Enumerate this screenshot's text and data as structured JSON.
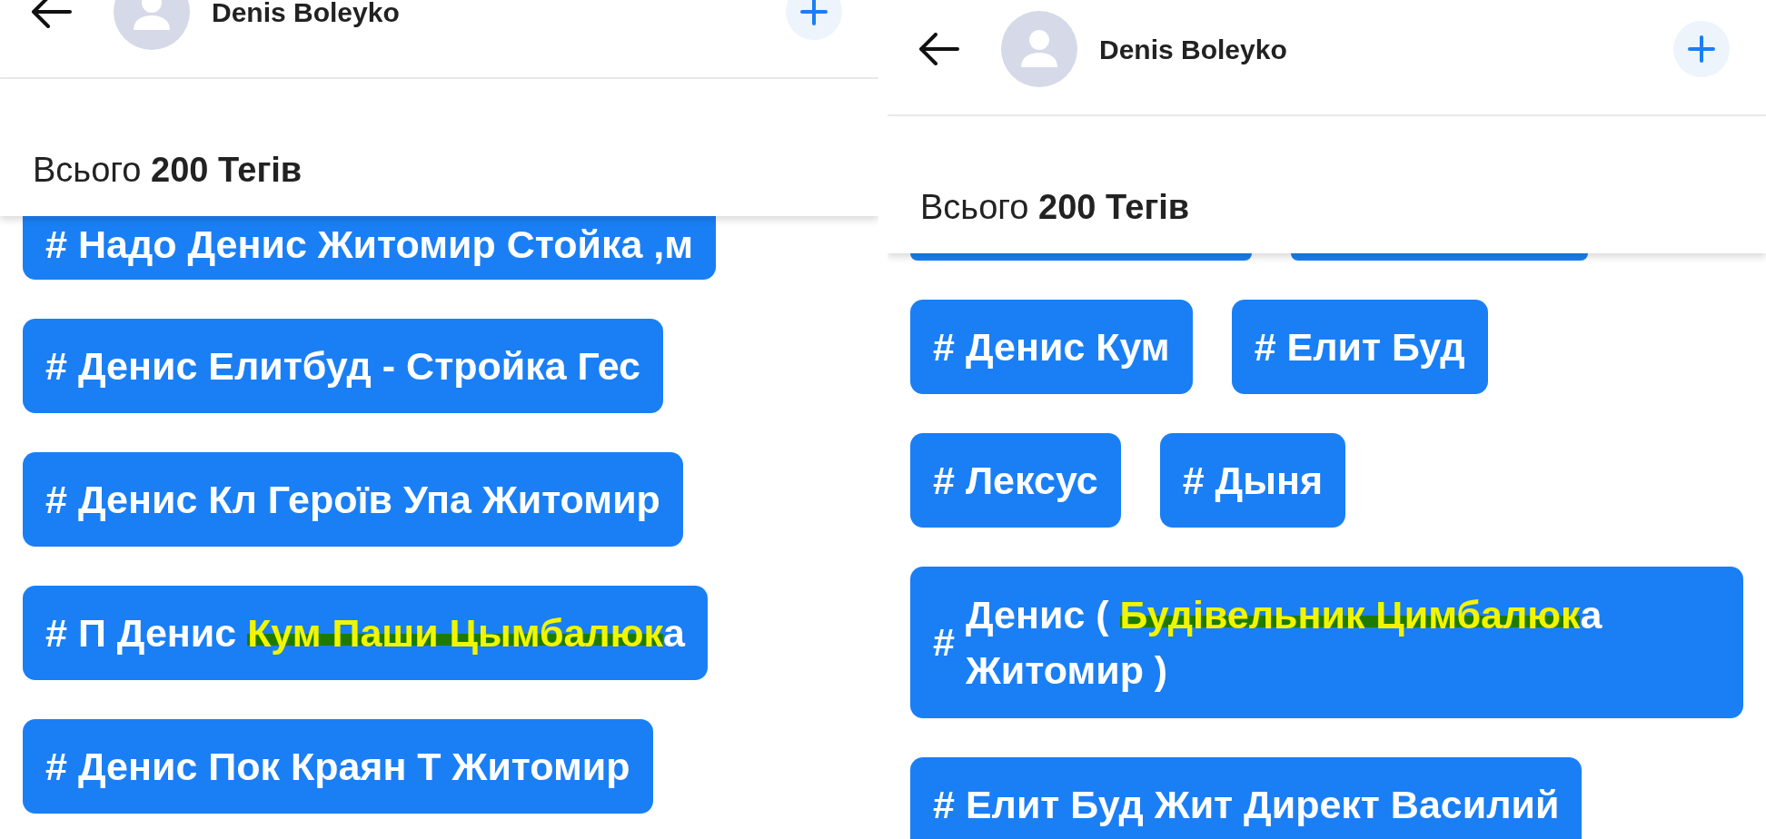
{
  "panels": [
    {
      "header": {
        "title": "Denis Boleyko"
      },
      "total": "Всього **200 Тегів**",
      "tag_rows": [
        [
          {
            "kind": "cut-top",
            "hash": "#",
            "parts": [
              {
                "text": "Надо Денис Житомир Стойка ,м",
                "highlighted": false
              }
            ]
          }
        ],
        [
          {
            "kind": "tag",
            "hash": "#",
            "parts": [
              {
                "text": "Денис Елитбуд - Стройка Гес",
                "highlighted": false
              }
            ]
          }
        ],
        [
          {
            "kind": "tag",
            "hash": "#",
            "parts": [
              {
                "text": "Денис Кл Героїв Упа Житомир",
                "highlighted": false
              }
            ]
          }
        ],
        [
          {
            "kind": "tag",
            "hash": "#",
            "parts": [
              {
                "text": "П Денис ",
                "highlighted": false
              },
              {
                "text": "Кум Паши Цымбалюк",
                "highlighted": true
              },
              {
                "text": "а",
                "highlighted": false
              }
            ]
          }
        ],
        [
          {
            "kind": "tag",
            "hash": "#",
            "parts": [
              {
                "text": "Денис Пок Краян Т Житомир",
                "highlighted": false
              }
            ]
          }
        ]
      ]
    },
    {
      "header": {
        "title": "Denis Boleyko"
      },
      "total": "Всього **200 Тегів**",
      "tag_rows": [
        [
          {
            "kind": "sliver"
          },
          {
            "kind": "sliver"
          }
        ],
        [
          {
            "kind": "tag",
            "hash": "#",
            "parts": [
              {
                "text": "Денис Кум",
                "highlighted": false
              }
            ]
          },
          {
            "kind": "tag",
            "hash": "#",
            "parts": [
              {
                "text": "Елит Буд",
                "highlighted": false
              }
            ]
          }
        ],
        [
          {
            "kind": "tag",
            "hash": "#",
            "parts": [
              {
                "text": "Лексус",
                "highlighted": false
              }
            ]
          },
          {
            "kind": "tag",
            "hash": "#",
            "parts": [
              {
                "text": "Дыня",
                "highlighted": false
              }
            ]
          }
        ],
        [
          {
            "kind": "wide",
            "hash": "#",
            "parts": [
              {
                "text": "Денис ( ",
                "highlighted": false
              },
              {
                "text": "Будівельник Цимбалюк",
                "highlighted": true
              },
              {
                "text": "а Житомир )",
                "highlighted": false
              }
            ]
          }
        ],
        [
          {
            "kind": "tag",
            "hash": "#",
            "parts": [
              {
                "text": "Елит Буд Жит Директ Василий",
                "highlighted": false
              }
            ]
          }
        ]
      ]
    }
  ]
}
